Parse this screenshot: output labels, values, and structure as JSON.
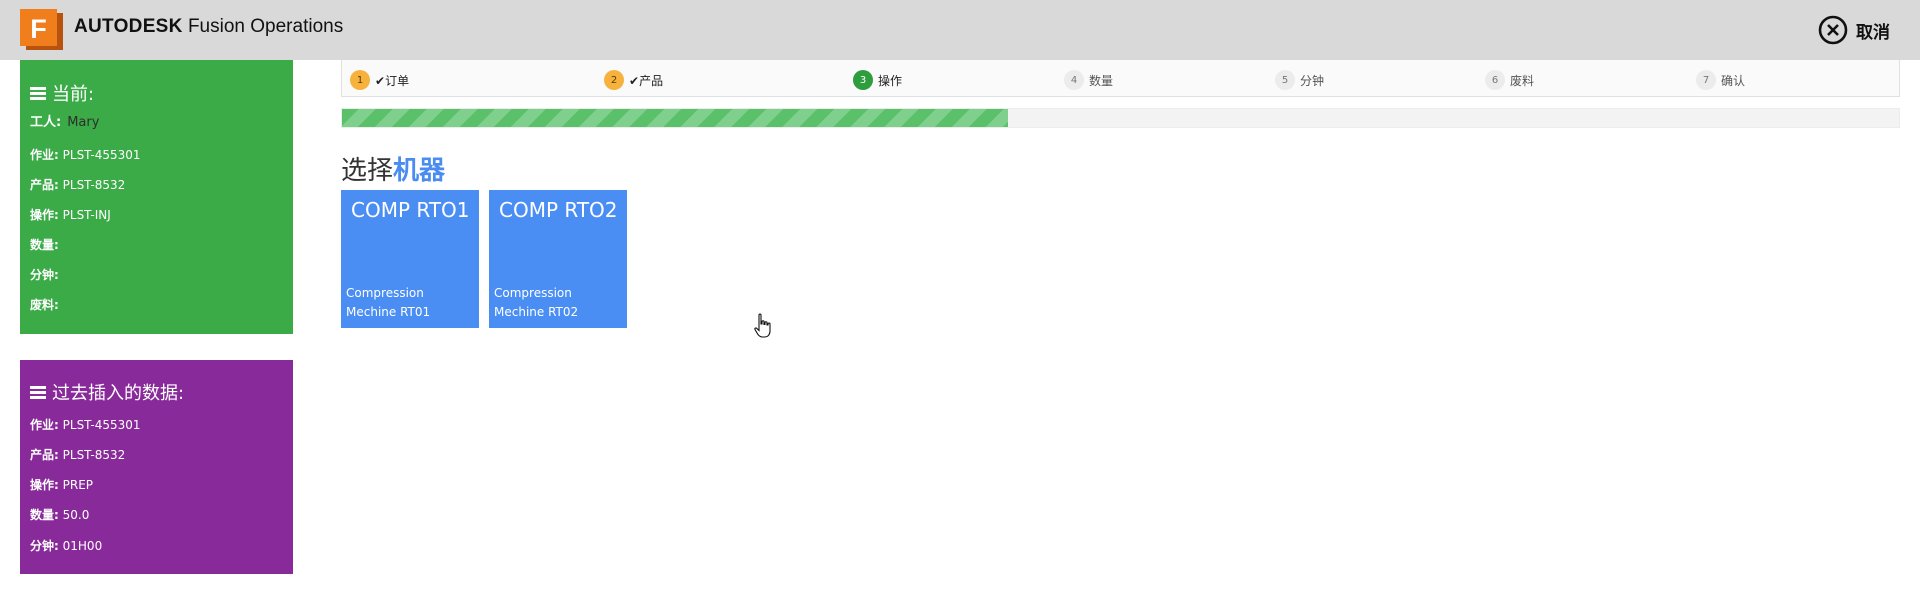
{
  "header": {
    "brand_bold": "AUTODESK",
    "brand_product": "Fusion Operations",
    "cancel_label": "取消",
    "logo_letter": "F",
    "brand_color": "#f07e1d"
  },
  "current_panel": {
    "title": "当前:",
    "worker_label": "工人:",
    "worker_value": "Mary",
    "rows": [
      {
        "label": "作业:",
        "value": "PLST-455301"
      },
      {
        "label": "产品:",
        "value": "PLST-8532"
      },
      {
        "label": "操作:",
        "value": "PLST-INJ"
      },
      {
        "label": "数量:",
        "value": ""
      },
      {
        "label": "分钟:",
        "value": ""
      },
      {
        "label": "废料:",
        "value": ""
      }
    ],
    "color": "#3aab47"
  },
  "past_panel": {
    "title": "过去插入的数据:",
    "rows": [
      {
        "label": "作业:",
        "value": "PLST-455301"
      },
      {
        "label": "产品:",
        "value": "PLST-8532"
      },
      {
        "label": "操作:",
        "value": "PREP"
      },
      {
        "label": "数量:",
        "value": "50.0"
      },
      {
        "label": "分钟:",
        "value": "01H00"
      }
    ],
    "color": "#882a99"
  },
  "stepper": {
    "steps": [
      {
        "num": "1",
        "label": "订单",
        "state": "done"
      },
      {
        "num": "2",
        "label": "产品",
        "state": "done"
      },
      {
        "num": "3",
        "label": "操作",
        "state": "active"
      },
      {
        "num": "4",
        "label": "数量",
        "state": "todo"
      },
      {
        "num": "5",
        "label": "分钟",
        "state": "todo"
      },
      {
        "num": "6",
        "label": "废料",
        "state": "todo"
      },
      {
        "num": "7",
        "label": "确认",
        "state": "todo"
      }
    ],
    "check_glyph": "✔"
  },
  "progress": {
    "fraction": 0.428
  },
  "main": {
    "title_prefix": "选择",
    "title_accent": "机器",
    "machines": [
      {
        "title": "COMP RTO1",
        "subtitle": "Compression Mechine RT01"
      },
      {
        "title": "COMP RTO2",
        "subtitle": "Compression Mechine RT02"
      }
    ],
    "accent_color": "#4a8ef4"
  }
}
